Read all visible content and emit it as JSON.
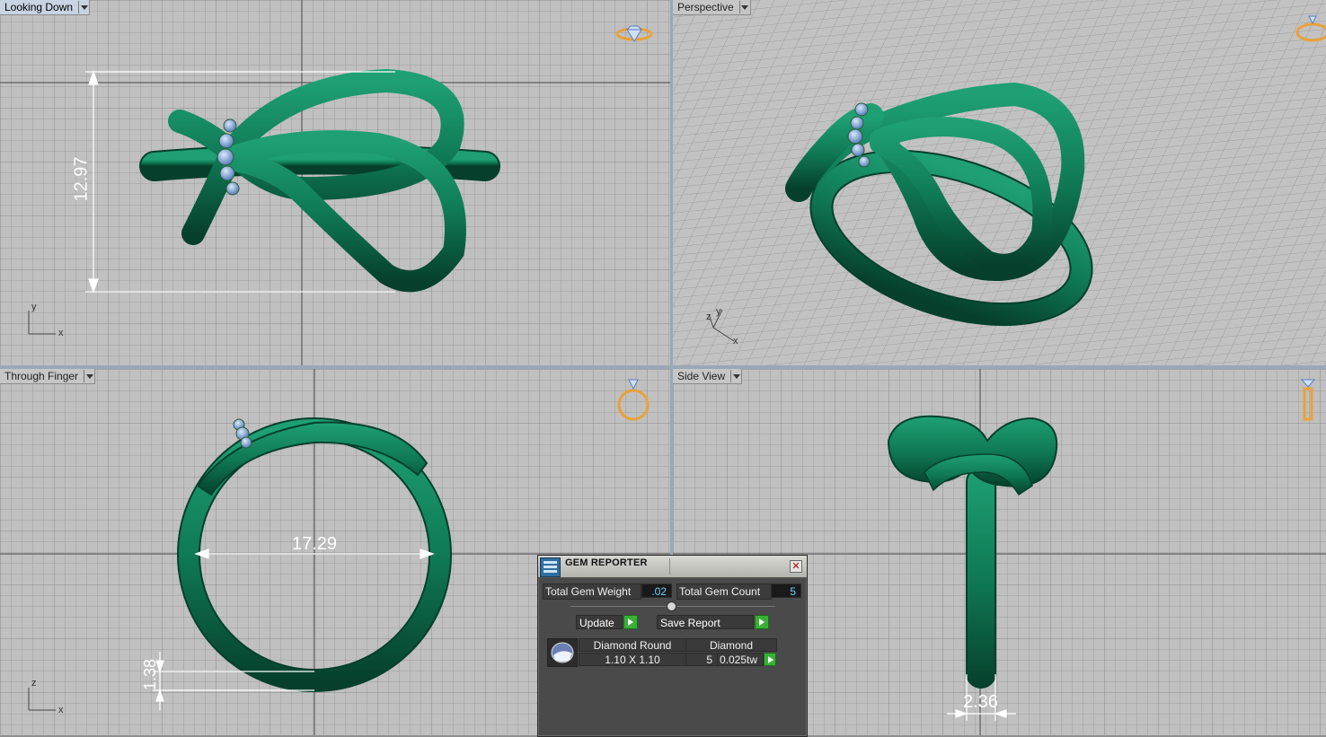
{
  "viewports": {
    "top_left": {
      "label": "Looking Down",
      "dimension": "12.97",
      "axis_y": "y",
      "axis_x": "x"
    },
    "top_right": {
      "label": "Perspective",
      "axis_y": "y",
      "axis_z": "z",
      "axis_x": "x"
    },
    "bottom_left": {
      "label": "Through Finger",
      "dimension_width": "17.29",
      "dimension_thickness": "1.38",
      "axis_z": "z",
      "axis_x": "x"
    },
    "bottom_right": {
      "label": "Side View",
      "dimension": "2.36"
    }
  },
  "gem_reporter": {
    "title": "GEM REPORTER",
    "total_weight_label": "Total Gem Weight",
    "total_weight_value": ".02",
    "total_count_label": "Total Gem Count",
    "total_count_value": "5",
    "update_label": "Update",
    "save_report_label": "Save Report",
    "table": {
      "col1_header": "Diamond Round",
      "col2_header": "Diamond",
      "size": "1.10 X 1.10",
      "count": "5",
      "weight": "0.025tw"
    }
  },
  "colors": {
    "metal": "#0f7a55",
    "gem": "#8fb8e6",
    "grid_bg": "#c0c0c0",
    "gizmo": "#e8a23a"
  },
  "icons": [
    "diamond-gizmo-icon",
    "ring-gizmo-icon",
    "gem-reporter-icon",
    "close-icon",
    "dropdown-arrow-icon",
    "round-diamond-icon"
  ]
}
